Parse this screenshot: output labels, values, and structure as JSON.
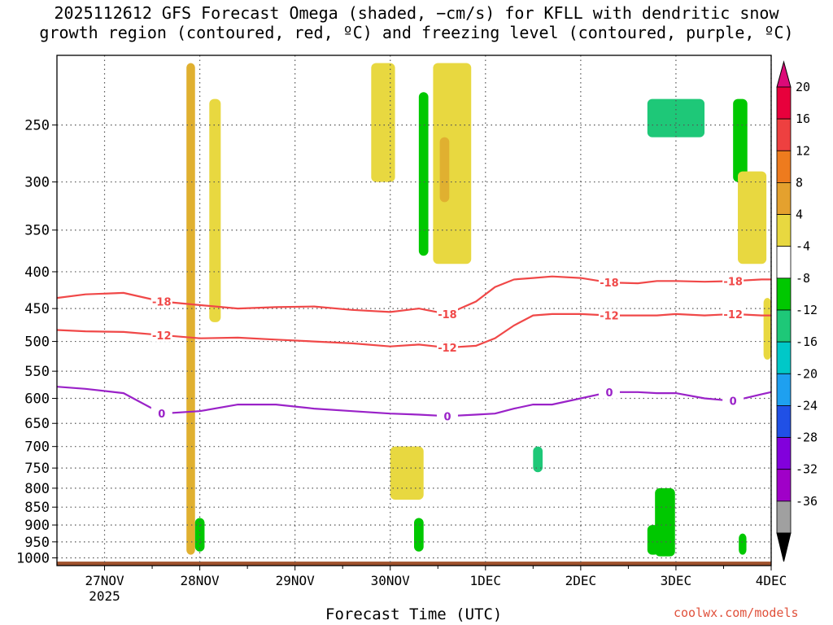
{
  "title_line1": "2025112612 GFS Forecast Omega (shaded, −cm/s) for KFLL with dendritic snow",
  "title_line2": "growth region (contoured, red, ºC) and freezing level (contoured, purple, ºC)",
  "credit": "coolwx.com/models",
  "chart_data": {
    "type": "heatmap",
    "title": "2025112612 GFS Forecast Omega (shaded, −cm/s) for KFLL with dendritic snow growth region (contoured, red, ºC) and freezing level (contoured, purple, ºC)",
    "xlabel": "Forecast Time (UTC)",
    "ylabel": "",
    "x_ticks": [
      {
        "day": 1.0,
        "label": "27NOV",
        "sub": "2025"
      },
      {
        "day": 2.0,
        "label": "28NOV",
        "sub": ""
      },
      {
        "day": 3.0,
        "label": "29NOV",
        "sub": ""
      },
      {
        "day": 4.0,
        "label": "30NOV",
        "sub": ""
      },
      {
        "day": 5.0,
        "label": "1DEC",
        "sub": ""
      },
      {
        "day": 6.0,
        "label": "2DEC",
        "sub": ""
      },
      {
        "day": 7.0,
        "label": "3DEC",
        "sub": ""
      },
      {
        "day": 8.0,
        "label": "4DEC",
        "sub": ""
      }
    ],
    "xlim": [
      0.5,
      8.0
    ],
    "y_ticks": [
      250,
      300,
      350,
      400,
      450,
      500,
      550,
      600,
      650,
      700,
      750,
      800,
      850,
      900,
      950,
      1000
    ],
    "ylim": [
      200,
      1025
    ],
    "y_scale": "log",
    "grid": true,
    "colorbar": {
      "labels": [
        "20",
        "16",
        "12",
        "8",
        "4",
        "-4",
        "-8",
        "-12",
        "-16",
        "-20",
        "-24",
        "-28",
        "-32",
        "-36"
      ],
      "colors": [
        "#e8003c",
        "#ee4040",
        "#ee7b1e",
        "#e4a12e",
        "#e8c838",
        "#e8e040",
        "#ffffff",
        "#00c800",
        "#1ec878",
        "#00c8c8",
        "#1ea0f0",
        "#2050e6",
        "#8200dc",
        "#a000c8",
        "#a0a0a0"
      ],
      "top_arrow_color": "#dc0a78",
      "bottom_arrow_color": "#000000"
    },
    "contours": [
      {
        "name": "-18",
        "color": "#f04848",
        "x": [
          0.5,
          0.8,
          1.2,
          1.6,
          2.0,
          2.4,
          2.8,
          3.2,
          3.6,
          4.0,
          4.3,
          4.6,
          4.9,
          5.1,
          5.3,
          5.5,
          5.7,
          6.0,
          6.3,
          6.6,
          6.8,
          7.0,
          7.3,
          7.6,
          7.9,
          8.0
        ],
        "y": [
          435,
          430,
          428,
          440,
          445,
          450,
          448,
          447,
          452,
          455,
          450,
          458,
          440,
          420,
          410,
          408,
          406,
          408,
          414,
          415,
          412,
          412,
          413,
          412,
          410,
          410
        ]
      },
      {
        "name": "-12",
        "color": "#f04848",
        "x": [
          0.5,
          0.8,
          1.2,
          1.6,
          2.0,
          2.4,
          2.8,
          3.2,
          3.6,
          4.0,
          4.3,
          4.6,
          4.9,
          5.1,
          5.3,
          5.5,
          5.7,
          6.0,
          6.3,
          6.6,
          6.8,
          7.0,
          7.3,
          7.6,
          7.9,
          8.0
        ],
        "y": [
          482,
          484,
          485,
          490,
          495,
          494,
          497,
          500,
          503,
          508,
          505,
          510,
          507,
          495,
          475,
          460,
          458,
          458,
          460,
          460,
          460,
          458,
          460,
          458,
          460,
          460
        ]
      },
      {
        "name": "0",
        "color": "#9a22c8",
        "x": [
          0.5,
          0.8,
          1.2,
          1.6,
          2.0,
          2.4,
          2.8,
          3.2,
          3.6,
          4.0,
          4.3,
          4.6,
          4.9,
          5.1,
          5.3,
          5.5,
          5.7,
          6.0,
          6.3,
          6.6,
          6.8,
          7.0,
          7.3,
          7.6,
          7.9,
          8.0
        ],
        "y": [
          578,
          582,
          590,
          630,
          625,
          612,
          612,
          620,
          625,
          630,
          632,
          635,
          632,
          630,
          620,
          612,
          612,
          600,
          588,
          588,
          590,
          590,
          600,
          605,
          592,
          588
        ]
      }
    ],
    "shaded_patches": [
      {
        "cat": "8",
        "x0": 1.86,
        "x1": 1.95,
        "p0": 205,
        "p1": 990
      },
      {
        "cat": "4",
        "x0": 2.1,
        "x1": 2.22,
        "p0": 230,
        "p1": 470
      },
      {
        "cat": "4",
        "x0": 3.8,
        "x1": 4.05,
        "p0": 205,
        "p1": 300
      },
      {
        "cat": "4",
        "x0": 4.45,
        "x1": 4.85,
        "p0": 205,
        "p1": 390
      },
      {
        "cat": "8",
        "x0": 4.52,
        "x1": 4.62,
        "p0": 260,
        "p1": 320
      },
      {
        "cat": "-4",
        "x0": 4.3,
        "x1": 4.4,
        "p0": 225,
        "p1": 380
      },
      {
        "cat": "-8",
        "x0": 6.7,
        "x1": 7.3,
        "p0": 230,
        "p1": 260
      },
      {
        "cat": "-4",
        "x0": 7.6,
        "x1": 7.75,
        "p0": 230,
        "p1": 300
      },
      {
        "cat": "4",
        "x0": 7.65,
        "x1": 7.95,
        "p0": 290,
        "p1": 390
      },
      {
        "cat": "4",
        "x0": 7.92,
        "x1": 8.0,
        "p0": 435,
        "p1": 530
      },
      {
        "cat": "4",
        "x0": 4.0,
        "x1": 4.35,
        "p0": 700,
        "p1": 830
      },
      {
        "cat": "-4",
        "x0": 4.25,
        "x1": 4.35,
        "p0": 880,
        "p1": 980
      },
      {
        "cat": "-4",
        "x0": 1.95,
        "x1": 2.05,
        "p0": 880,
        "p1": 980
      },
      {
        "cat": "-36",
        "x0": 6.86,
        "x1": 6.91,
        "p0": 870,
        "p1": 930
      },
      {
        "cat": "-28",
        "x0": 6.84,
        "x1": 6.93,
        "p0": 855,
        "p1": 960
      },
      {
        "cat": "-12",
        "x0": 6.82,
        "x1": 6.96,
        "p0": 830,
        "p1": 985
      },
      {
        "cat": "-4",
        "x0": 6.78,
        "x1": 6.99,
        "p0": 800,
        "p1": 995
      },
      {
        "cat": "-8",
        "x0": 5.5,
        "x1": 5.6,
        "p0": 700,
        "p1": 760
      },
      {
        "cat": "-4",
        "x0": 6.7,
        "x1": 6.82,
        "p0": 900,
        "p1": 990
      },
      {
        "cat": "-4",
        "x0": 7.66,
        "x1": 7.74,
        "p0": 925,
        "p1": 990
      }
    ]
  }
}
